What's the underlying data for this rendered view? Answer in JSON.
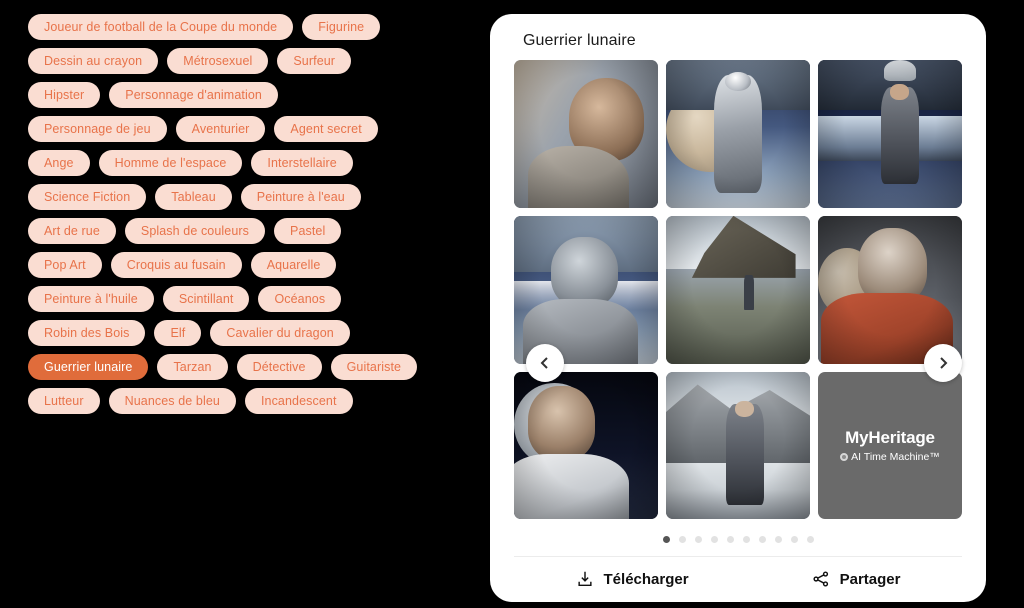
{
  "colors": {
    "background": "#000000",
    "tag_bg": "#FADDD2",
    "tag_text": "#E8734A",
    "tag_selected_bg": "#E06C3B",
    "tag_selected_text": "#FFFFFF",
    "card_bg": "#FFFFFF",
    "watermark_bg": "#6A6A6A",
    "dot_active": "#555555",
    "dot_inactive": "#E2E2E2"
  },
  "tag_panel": {
    "name": "style-tag-cloud",
    "rows": [
      [
        {
          "label": "Joueur de football de la Coupe du monde",
          "selected": false
        },
        {
          "label": "Figurine",
          "selected": false
        }
      ],
      [
        {
          "label": "Dessin au crayon",
          "selected": false
        },
        {
          "label": "Métrosexuel",
          "selected": false
        },
        {
          "label": "Surfeur",
          "selected": false
        }
      ],
      [
        {
          "label": "Hipster",
          "selected": false
        },
        {
          "label": "Personnage d'animation",
          "selected": false
        }
      ],
      [
        {
          "label": "Personnage de jeu",
          "selected": false
        },
        {
          "label": "Aventurier",
          "selected": false
        },
        {
          "label": "Agent secret",
          "selected": false
        }
      ],
      [
        {
          "label": "Ange",
          "selected": false
        },
        {
          "label": "Homme de l'espace",
          "selected": false
        },
        {
          "label": "Interstellaire",
          "selected": false
        }
      ],
      [
        {
          "label": "Science Fiction",
          "selected": false
        },
        {
          "label": "Tableau",
          "selected": false
        },
        {
          "label": "Peinture à l'eau",
          "selected": false
        }
      ],
      [
        {
          "label": "Art de rue",
          "selected": false
        },
        {
          "label": "Splash de couleurs",
          "selected": false
        },
        {
          "label": "Pastel",
          "selected": false
        }
      ],
      [
        {
          "label": "Pop Art",
          "selected": false
        },
        {
          "label": "Croquis au fusain",
          "selected": false
        },
        {
          "label": "Aquarelle",
          "selected": false
        }
      ],
      [
        {
          "label": "Peinture à l'huile",
          "selected": false
        },
        {
          "label": "Scintillant",
          "selected": false
        },
        {
          "label": "Océanos",
          "selected": false
        }
      ],
      [
        {
          "label": "Robin des Bois",
          "selected": false
        },
        {
          "label": "Elf",
          "selected": false
        },
        {
          "label": "Cavalier du dragon",
          "selected": false
        }
      ],
      [
        {
          "label": "Guerrier lunaire",
          "selected": true
        },
        {
          "label": "Tarzan",
          "selected": false
        },
        {
          "label": "Détective",
          "selected": false
        },
        {
          "label": "Guitariste",
          "selected": false
        }
      ],
      [
        {
          "label": "Lutteur",
          "selected": false
        },
        {
          "label": "Nuances de bleu",
          "selected": false
        },
        {
          "label": "Incandescent",
          "selected": false
        }
      ]
    ]
  },
  "card": {
    "title": "Guerrier lunaire",
    "prev_label": "‹",
    "next_label": "›",
    "tiles": [
      {
        "alt": "portrait-hand-on-chin",
        "kind": "portrait-warm"
      },
      {
        "alt": "astronaut-walking-moon",
        "kind": "astronaut-moon"
      },
      {
        "alt": "soldier-on-rock-starfield",
        "kind": "soldier-rock"
      },
      {
        "alt": "portrait-sky-backdrop",
        "kind": "portrait-sky"
      },
      {
        "alt": "figure-on-cliff-overlook",
        "kind": "cliff-overlook"
      },
      {
        "alt": "portrait-orange-hood",
        "kind": "portrait-hood"
      },
      {
        "alt": "portrait-white-shirt-moon",
        "kind": "portrait-moon"
      },
      {
        "alt": "armored-warrior-mountain",
        "kind": "armored-mountain"
      },
      {
        "alt": "myheritage-watermark",
        "kind": "watermark"
      }
    ],
    "watermark": {
      "brand": "MyHeritage",
      "product": "AI Time Machine™"
    },
    "pagination": {
      "total": 10,
      "active_index": 0
    },
    "footer": {
      "download_label": "Télécharger",
      "share_label": "Partager"
    }
  }
}
